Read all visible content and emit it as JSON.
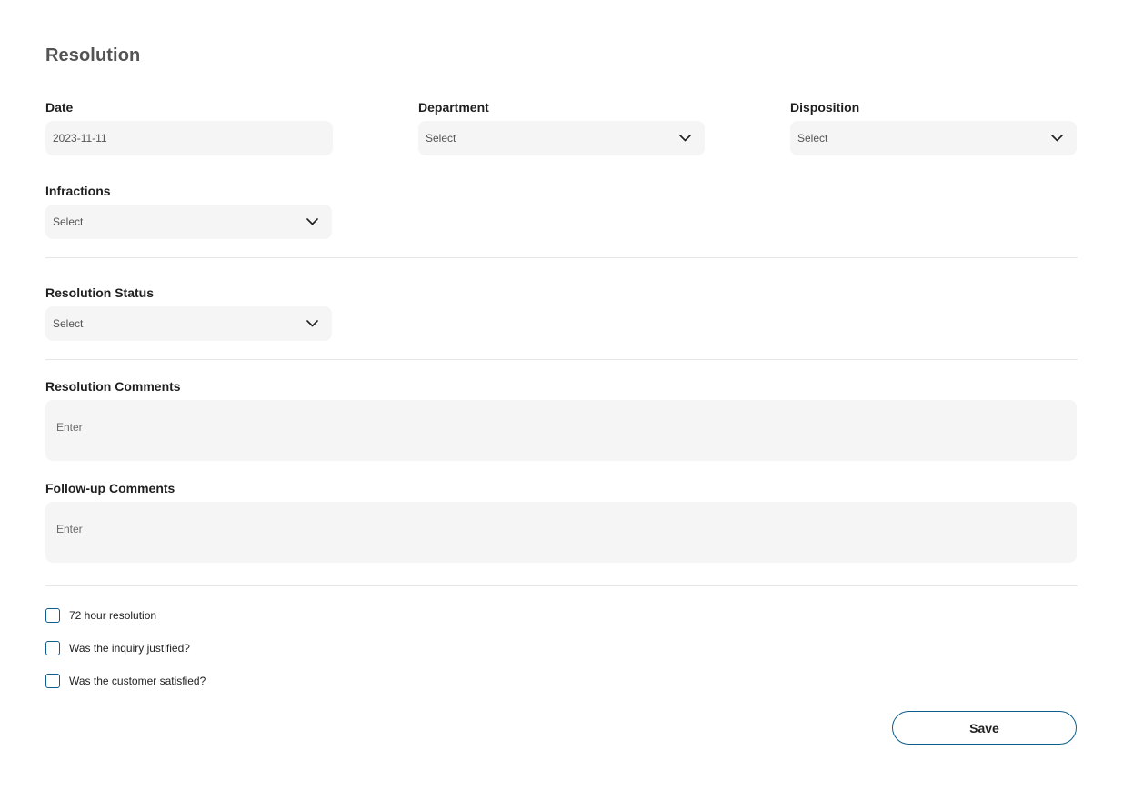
{
  "form": {
    "title": "Resolution",
    "date": {
      "label": "Date",
      "value": "2023-11-11"
    },
    "department": {
      "label": "Department",
      "value": "Select"
    },
    "disposition": {
      "label": "Disposition",
      "value": "Select"
    },
    "infractions": {
      "label": "Infractions",
      "value": "Select"
    },
    "resolution_status": {
      "label": "Resolution Status",
      "value": "Select"
    },
    "resolution_comments": {
      "label": "Resolution Comments",
      "placeholder": "Enter"
    },
    "followup_comments": {
      "label": "Follow-up Comments",
      "placeholder": "Enter"
    },
    "checkboxes": [
      {
        "label": "72 hour resolution",
        "checked": false
      },
      {
        "label": "Was the inquiry justified?",
        "checked": false
      },
      {
        "label": "Was the customer satisfied?",
        "checked": false
      }
    ],
    "save_label": "Save"
  },
  "colors": {
    "accent": "#0e5e8c",
    "field_bg": "#f5f5f5",
    "divider": "#e6e6e6",
    "title": "#545454"
  }
}
